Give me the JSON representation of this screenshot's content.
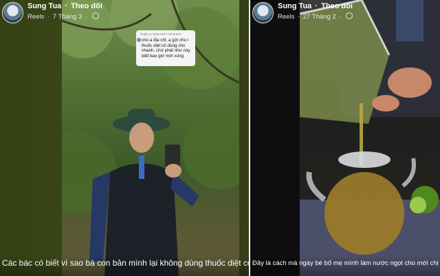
{
  "posts": [
    {
      "author": "Sung Tua",
      "separator": "·",
      "follow_label": "Theo dõi",
      "type": "Reels",
      "date": "7 Tháng 3",
      "globe_icon": "globe-icon",
      "comment_bubble": {
        "header": "Reply to Chau Bui's comment",
        "text": "cho a địa chỉ, a gửi cho í thuốc diệt cỏ dùng cho nhanh, chứ phát như này biết bao giờ mới xong"
      },
      "caption": "Các bác có biết vì sao bà con bản mình lại không dùng thuốc diệt cỏ"
    },
    {
      "author": "Sung Tua",
      "separator": "·",
      "follow_label": "Theo dõi",
      "type": "Reels",
      "date": "27 Tháng 2",
      "globe_icon": "globe-icon",
      "caption": "Đây là cách mà ngày bé bố mẹ mình làm nước ngọt cho mới chị em"
    }
  ],
  "colors": {
    "card1_bg": "#3b4818",
    "card2_bg": "#0e0e10",
    "text": "#ffffff"
  }
}
